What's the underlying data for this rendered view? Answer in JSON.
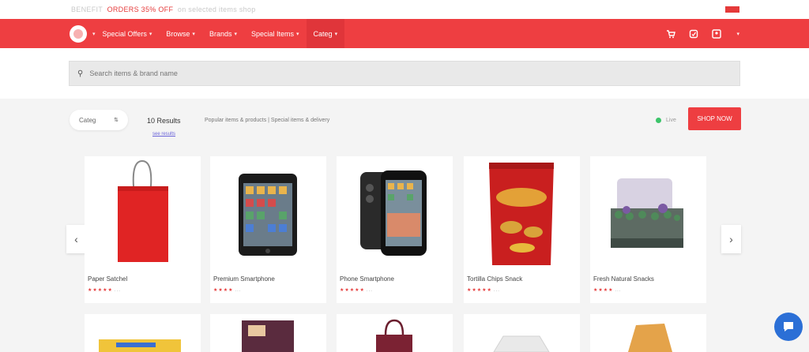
{
  "topbar": {
    "left_text": "BENEFIT",
    "promo_text": "ORDERS 35% OFF",
    "promo_rest": "on selected items shop",
    "flag_name": "region-flag-icon"
  },
  "nav": {
    "logo_name": "store-logo",
    "items": [
      {
        "label": "Special Offers"
      },
      {
        "label": "Browse"
      },
      {
        "label": "Brands"
      },
      {
        "label": "Special Items"
      },
      {
        "label": "Categ"
      }
    ],
    "icons": [
      "cart-icon",
      "favorite-icon",
      "account-icon"
    ]
  },
  "search": {
    "placeholder": "Search items & brand name"
  },
  "filters": {
    "sort_label": "Categ",
    "results_label": "10 Results",
    "results_link": "see results",
    "description": "Popular items & products | Special items & delivery",
    "status_label": "Live",
    "cta_label": "SHOP NOW"
  },
  "products": [
    {
      "name": "Paper Satchel",
      "stars": "★★★★★",
      "more": "..."
    },
    {
      "name": "Premium Smartphone",
      "stars": "★★★★",
      "more": "..."
    },
    {
      "name": "Phone Smartphone",
      "stars": "★★★★★",
      "more": "..."
    },
    {
      "name": "Tortilla Chips Snack",
      "stars": "★★★★★",
      "more": "..."
    },
    {
      "name": "Fresh Natural Snacks",
      "stars": "★★★★",
      "more": "..."
    }
  ],
  "colors": {
    "brand": "#ee3e41",
    "accent_link": "#6a63d9",
    "status_ok": "#3cc46a",
    "chat": "#2b6fd6"
  }
}
